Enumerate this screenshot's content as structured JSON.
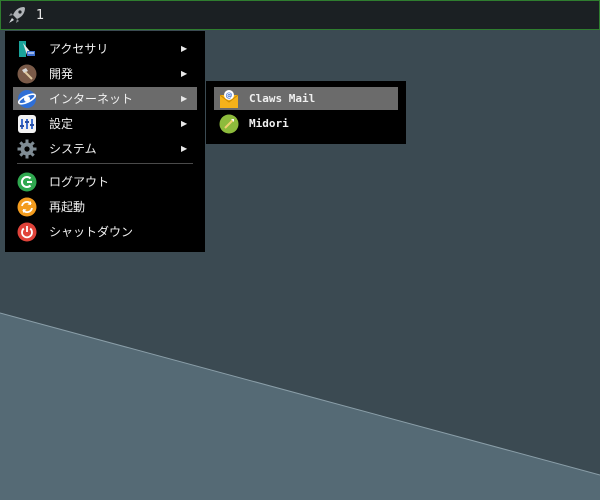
{
  "taskbar": {
    "launcher_icon": "rocket-icon",
    "workspace_label": "1",
    "border_color": "#2f7d2f"
  },
  "desktop": {
    "background_color": "#3b4a52",
    "wedge_color": "#5a6f7a"
  },
  "main_menu": {
    "items": [
      {
        "label": "アクセサリ",
        "icon": "accessories-icon",
        "has_submenu": true
      },
      {
        "label": "開発",
        "icon": "development-icon",
        "has_submenu": true
      },
      {
        "label": "インターネット",
        "icon": "internet-icon",
        "has_submenu": true,
        "active": true
      },
      {
        "label": "設定",
        "icon": "settings-icon",
        "has_submenu": true
      },
      {
        "label": "システム",
        "icon": "system-gear-icon",
        "has_submenu": true
      }
    ],
    "actions": [
      {
        "label": "ログアウト",
        "icon": "logout-icon"
      },
      {
        "label": "再起動",
        "icon": "reboot-icon"
      },
      {
        "label": "シャットダウン",
        "icon": "shutdown-icon"
      }
    ],
    "arrow_glyph": "▶"
  },
  "sub_menu": {
    "items": [
      {
        "label": "Claws Mail",
        "icon": "claws-mail-icon",
        "active": true
      },
      {
        "label": "Midori",
        "icon": "midori-icon"
      }
    ]
  },
  "colors": {
    "active_bg": "#6b6b6b",
    "menu_bg": "#000000"
  }
}
